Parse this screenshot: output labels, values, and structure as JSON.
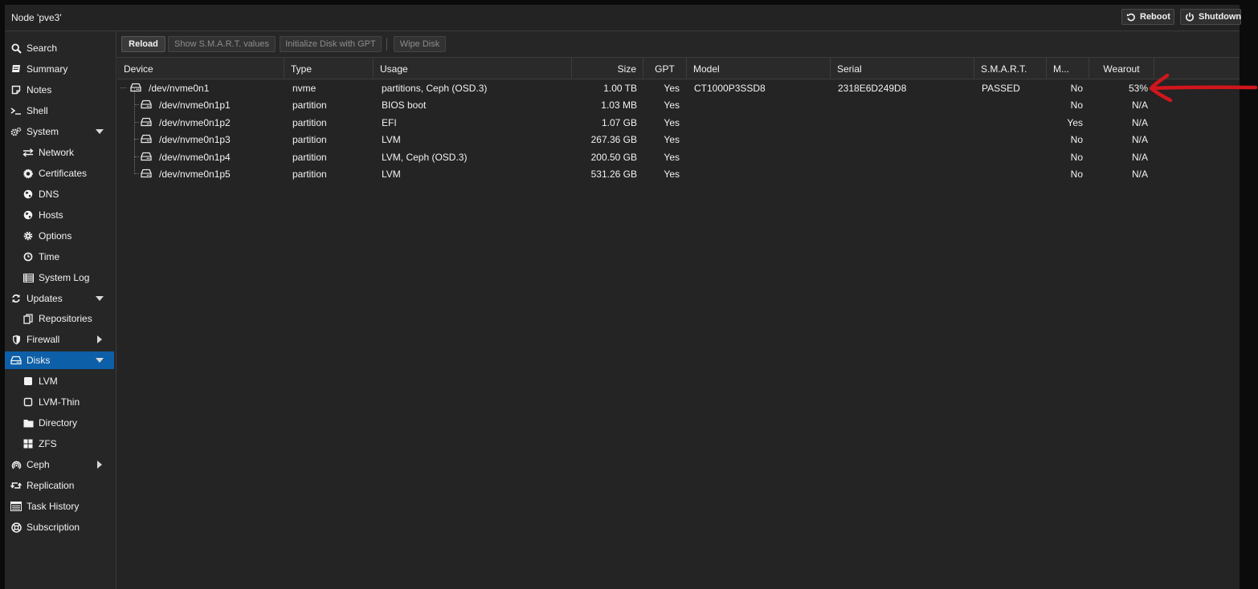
{
  "window": {
    "title": "Node 'pve3'"
  },
  "titlebar": {
    "reboot_label": "Reboot",
    "shutdown_label": "Shutdown"
  },
  "sidebar": {
    "items": [
      {
        "label": "Search",
        "icon": "search-icon"
      },
      {
        "label": "Summary",
        "icon": "book-icon"
      },
      {
        "label": "Notes",
        "icon": "notes-icon"
      },
      {
        "label": "Shell",
        "icon": "terminal-icon"
      },
      {
        "label": "System",
        "icon": "gears-icon",
        "expanded": true
      },
      {
        "label": "Network",
        "icon": "exchange-icon"
      },
      {
        "label": "Certificates",
        "icon": "certificate-icon"
      },
      {
        "label": "DNS",
        "icon": "globe-icon"
      },
      {
        "label": "Hosts",
        "icon": "globe-icon"
      },
      {
        "label": "Options",
        "icon": "gear-icon"
      },
      {
        "label": "Time",
        "icon": "clock-icon"
      },
      {
        "label": "System Log",
        "icon": "list-icon"
      },
      {
        "label": "Updates",
        "icon": "refresh-icon",
        "expanded": true
      },
      {
        "label": "Repositories",
        "icon": "files-icon"
      },
      {
        "label": "Firewall",
        "icon": "shield-icon",
        "expanded": false
      },
      {
        "label": "Disks",
        "icon": "hdd-icon",
        "expanded": true,
        "selected": true
      },
      {
        "label": "LVM",
        "icon": "square-icon"
      },
      {
        "label": "LVM-Thin",
        "icon": "square-outline-icon"
      },
      {
        "label": "Directory",
        "icon": "folder-icon"
      },
      {
        "label": "ZFS",
        "icon": "th-large-icon"
      },
      {
        "label": "Ceph",
        "icon": "ceph-icon",
        "expanded": false
      },
      {
        "label": "Replication",
        "icon": "retweet-icon"
      },
      {
        "label": "Task History",
        "icon": "list-alt-icon"
      },
      {
        "label": "Subscription",
        "icon": "support-icon"
      }
    ]
  },
  "toolbar": {
    "reload": "Reload",
    "show_smart": "Show S.M.A.R.T. values",
    "init_gpt": "Initialize Disk with GPT",
    "wipe": "Wipe Disk"
  },
  "grid": {
    "columns": {
      "device": "Device",
      "type": "Type",
      "usage": "Usage",
      "size": "Size",
      "gpt": "GPT",
      "model": "Model",
      "serial": "Serial",
      "smart": "S.M.A.R.T.",
      "mounted": "M...",
      "wearout": "Wearout"
    },
    "rows": [
      {
        "device": "/dev/nvme0n1",
        "type": "nvme",
        "usage": "partitions, Ceph (OSD.3)",
        "size": "1.00 TB",
        "gpt": "Yes",
        "model": "CT1000P3SSD8",
        "serial": "2318E6D249D8",
        "smart": "PASSED",
        "mounted": "No",
        "wearout": "53%"
      },
      {
        "device": "/dev/nvme0n1p1",
        "type": "partition",
        "usage": "BIOS boot",
        "size": "1.03 MB",
        "gpt": "Yes",
        "model": "",
        "serial": "",
        "smart": "",
        "mounted": "No",
        "wearout": "N/A"
      },
      {
        "device": "/dev/nvme0n1p2",
        "type": "partition",
        "usage": "EFI",
        "size": "1.07 GB",
        "gpt": "Yes",
        "model": "",
        "serial": "",
        "smart": "",
        "mounted": "Yes",
        "wearout": "N/A"
      },
      {
        "device": "/dev/nvme0n1p3",
        "type": "partition",
        "usage": "LVM",
        "size": "267.36 GB",
        "gpt": "Yes",
        "model": "",
        "serial": "",
        "smart": "",
        "mounted": "No",
        "wearout": "N/A"
      },
      {
        "device": "/dev/nvme0n1p4",
        "type": "partition",
        "usage": "LVM, Ceph (OSD.3)",
        "size": "200.50 GB",
        "gpt": "Yes",
        "model": "",
        "serial": "",
        "smart": "",
        "mounted": "No",
        "wearout": "N/A"
      },
      {
        "device": "/dev/nvme0n1p5",
        "type": "partition",
        "usage": "LVM",
        "size": "531.26 GB",
        "gpt": "Yes",
        "model": "",
        "serial": "",
        "smart": "",
        "mounted": "No",
        "wearout": "N/A"
      }
    ]
  },
  "colors": {
    "selected": "#0d5fa8",
    "annotation_arrow": "#d0161c",
    "background": "#262626"
  }
}
